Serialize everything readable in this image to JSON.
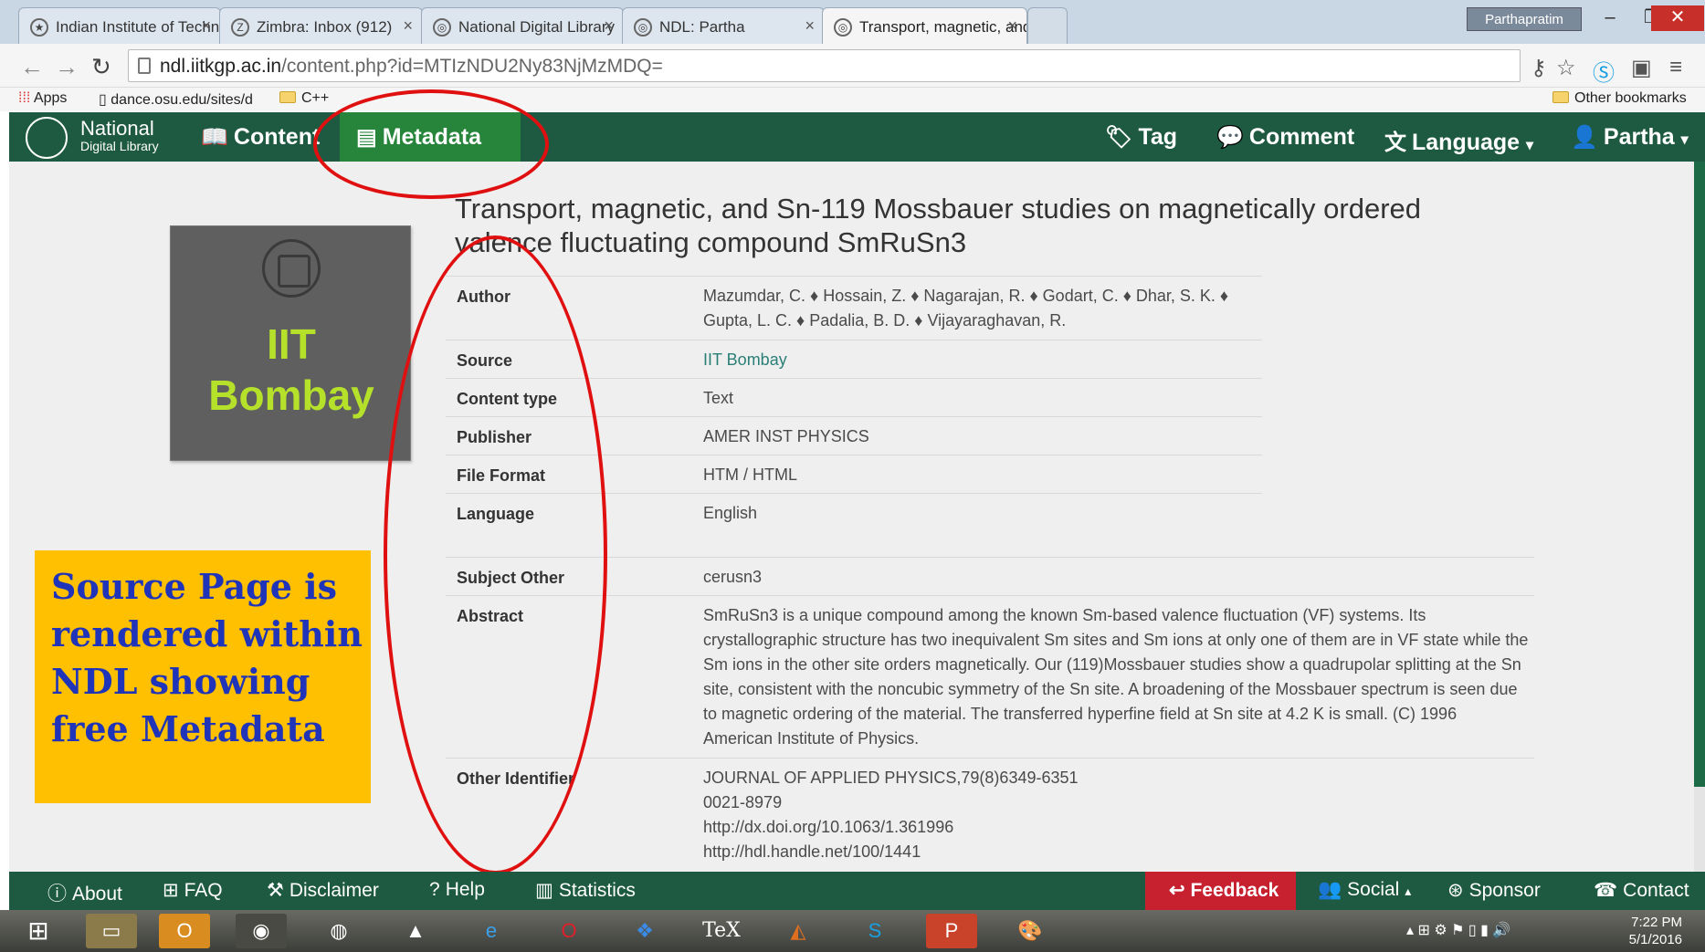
{
  "browser": {
    "tabs": [
      {
        "label": "Indian Institute of Techno",
        "active": false
      },
      {
        "label": "Zimbra: Inbox (912)",
        "active": false
      },
      {
        "label": "National Digital Library",
        "active": false
      },
      {
        "label": "NDL: Partha",
        "active": false
      },
      {
        "label": "Transport, magnetic, and",
        "active": true
      }
    ],
    "profile_name": "Parthapratim",
    "url_host": "ndl.iitkgp.ac.in",
    "url_path": "/content.php?id=MTIzNDU2Ny83NjMzMDQ=",
    "bookmarks": {
      "apps": "Apps",
      "item1": "dance.osu.edu/sites/d",
      "item2": "C++",
      "other": "Other bookmarks"
    }
  },
  "navbar": {
    "logo_line1": "National",
    "logo_line2": "Digital Library",
    "content": "Content",
    "metadata": "Metadata",
    "tag": "Tag",
    "comment": "Comment",
    "language": "Language",
    "user": "Partha"
  },
  "thumbnail": {
    "line1": "IIT",
    "line2": "Bombay"
  },
  "callout": "Source Page is rendered within NDL showing free Metadata",
  "record": {
    "title": "Transport, magnetic, and Sn-119 Mossbauer studies on magnetically ordered valence fluctuating compound SmRuSn3",
    "fields": [
      {
        "label": "Author",
        "value": "Mazumdar, C. ♦ Hossain, Z. ♦ Nagarajan, R. ♦ Godart, C. ♦ Dhar, S. K. ♦ Gupta, L. C. ♦ Padalia, B. D. ♦ Vijayaraghavan, R."
      },
      {
        "label": "Source",
        "value": "IIT Bombay"
      },
      {
        "label": "Content type",
        "value": "Text"
      },
      {
        "label": "Publisher",
        "value": "AMER INST PHYSICS"
      },
      {
        "label": "File Format",
        "value": "HTM / HTML"
      },
      {
        "label": "Language",
        "value": "English"
      },
      {
        "label": "Subject Other",
        "value": "cerusn3"
      },
      {
        "label": "Abstract",
        "value": "SmRuSn3 is a unique compound among the known Sm-based valence fluctuation (VF) systems. Its crystallographic structure has two inequivalent Sm sites and Sm ions at only one of them are in VF state while the Sm ions in the other site orders magnetically. Our (119)Mossbauer studies show a quadrupolar splitting at the Sn site, consistent with the noncubic symmetry of the Sn site. A broadening of the Mossbauer spectrum is seen due to magnetic ordering of the material. The transferred hyperfine field at Sn site at 4.2 K is small. (C) 1996 American Institute of Physics."
      },
      {
        "label": "Other Identifier",
        "value": "JOURNAL OF APPLIED PHYSICS,79(8)6349-6351"
      }
    ],
    "identifiers_extra": [
      "0021-8979",
      "http://dx.doi.org/10.1063/1.361996",
      "http://hdl.handle.net/100/1441"
    ]
  },
  "footer": {
    "about": "About",
    "faq": "FAQ",
    "disclaimer": "Disclaimer",
    "help": "Help",
    "statistics": "Statistics",
    "feedback": "Feedback",
    "social": "Social",
    "sponsor": "Sponsor",
    "contact": "Contact"
  },
  "taskbar": {
    "time": "7:22 PM",
    "date": "5/1/2016"
  },
  "colors": {
    "ndl_green": "#1d5a41",
    "metadata_active": "#27843b",
    "feedback_red": "#c7202f",
    "callout_bg": "#fec000",
    "callout_text": "#1f34b8",
    "annotation_red": "#e01010"
  }
}
